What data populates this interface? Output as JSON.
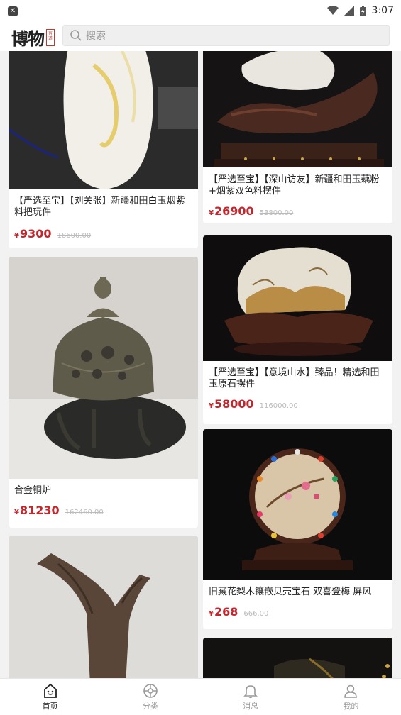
{
  "status": {
    "time": "3:07"
  },
  "header": {
    "logo_text": "博物",
    "logo_seal": "有道",
    "search_placeholder": "搜索"
  },
  "colors": {
    "price": "#c1272d",
    "background": "#f2f2f2"
  },
  "products": [
    {
      "title": "【严选至宝】【刘关张】新疆和田白玉烟紫料把玩件",
      "price": "9300",
      "original": "18600.00"
    },
    {
      "title": "合金铜炉",
      "price": "81230",
      "original": "162460.00"
    },
    {
      "title": "",
      "price": "",
      "original": ""
    },
    {
      "title": "【严选至宝】【深山访友】新疆和田玉藕粉+烟紫双色料摆件",
      "price": "26900",
      "original": "53800.00"
    },
    {
      "title": "【严选至宝】【意境山水】臻品！精选和田玉原石摆件",
      "price": "58000",
      "original": "116000.00"
    },
    {
      "title": "旧藏花梨木镶嵌贝壳宝石 双喜登梅 屏风",
      "price": "268",
      "original": "666.00"
    },
    {
      "title": "",
      "price": "",
      "original": ""
    }
  ],
  "currency_symbol": "¥",
  "tabs": [
    {
      "label": "首页",
      "icon": "home-icon",
      "active": true
    },
    {
      "label": "分类",
      "icon": "category-icon",
      "active": false
    },
    {
      "label": "消息",
      "icon": "bell-icon",
      "active": false
    },
    {
      "label": "我的",
      "icon": "user-icon",
      "active": false
    }
  ]
}
